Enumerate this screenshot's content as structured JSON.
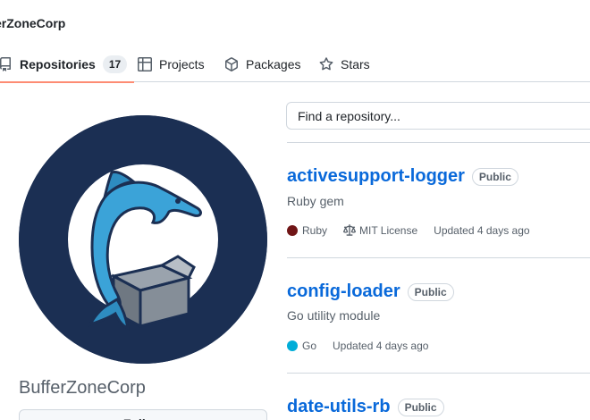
{
  "header": {
    "org_name": "erZoneCorp"
  },
  "tabs": [
    {
      "label": "Repositories",
      "count": "17",
      "icon": "repo-icon",
      "selected": true
    },
    {
      "label": "Projects",
      "icon": "table-icon"
    },
    {
      "label": "Packages",
      "icon": "package-icon"
    },
    {
      "label": "Stars",
      "icon": "star-icon"
    }
  ],
  "sidebar": {
    "avatar_icon": "dolphin-box-logo",
    "org_title": "BufferZoneCorp",
    "follow_label": "Follow"
  },
  "search": {
    "placeholder": "Find a repository..."
  },
  "repos": [
    {
      "name": "activesupport-logger",
      "visibility": "Public",
      "description": "Ruby gem",
      "language": "Ruby",
      "language_color": "#701516",
      "license": "MIT License",
      "updated": "Updated 4 days ago"
    },
    {
      "name": "config-loader",
      "visibility": "Public",
      "description": "Go utility module",
      "language": "Go",
      "language_color": "#00ADD8",
      "updated": "Updated 4 days ago"
    },
    {
      "name": "date-utils-rb",
      "visibility": "Public"
    }
  ],
  "colors": {
    "link": "#0969da",
    "tab_underline": "#fd8c73",
    "avatar_bg": "#1b2f53"
  }
}
